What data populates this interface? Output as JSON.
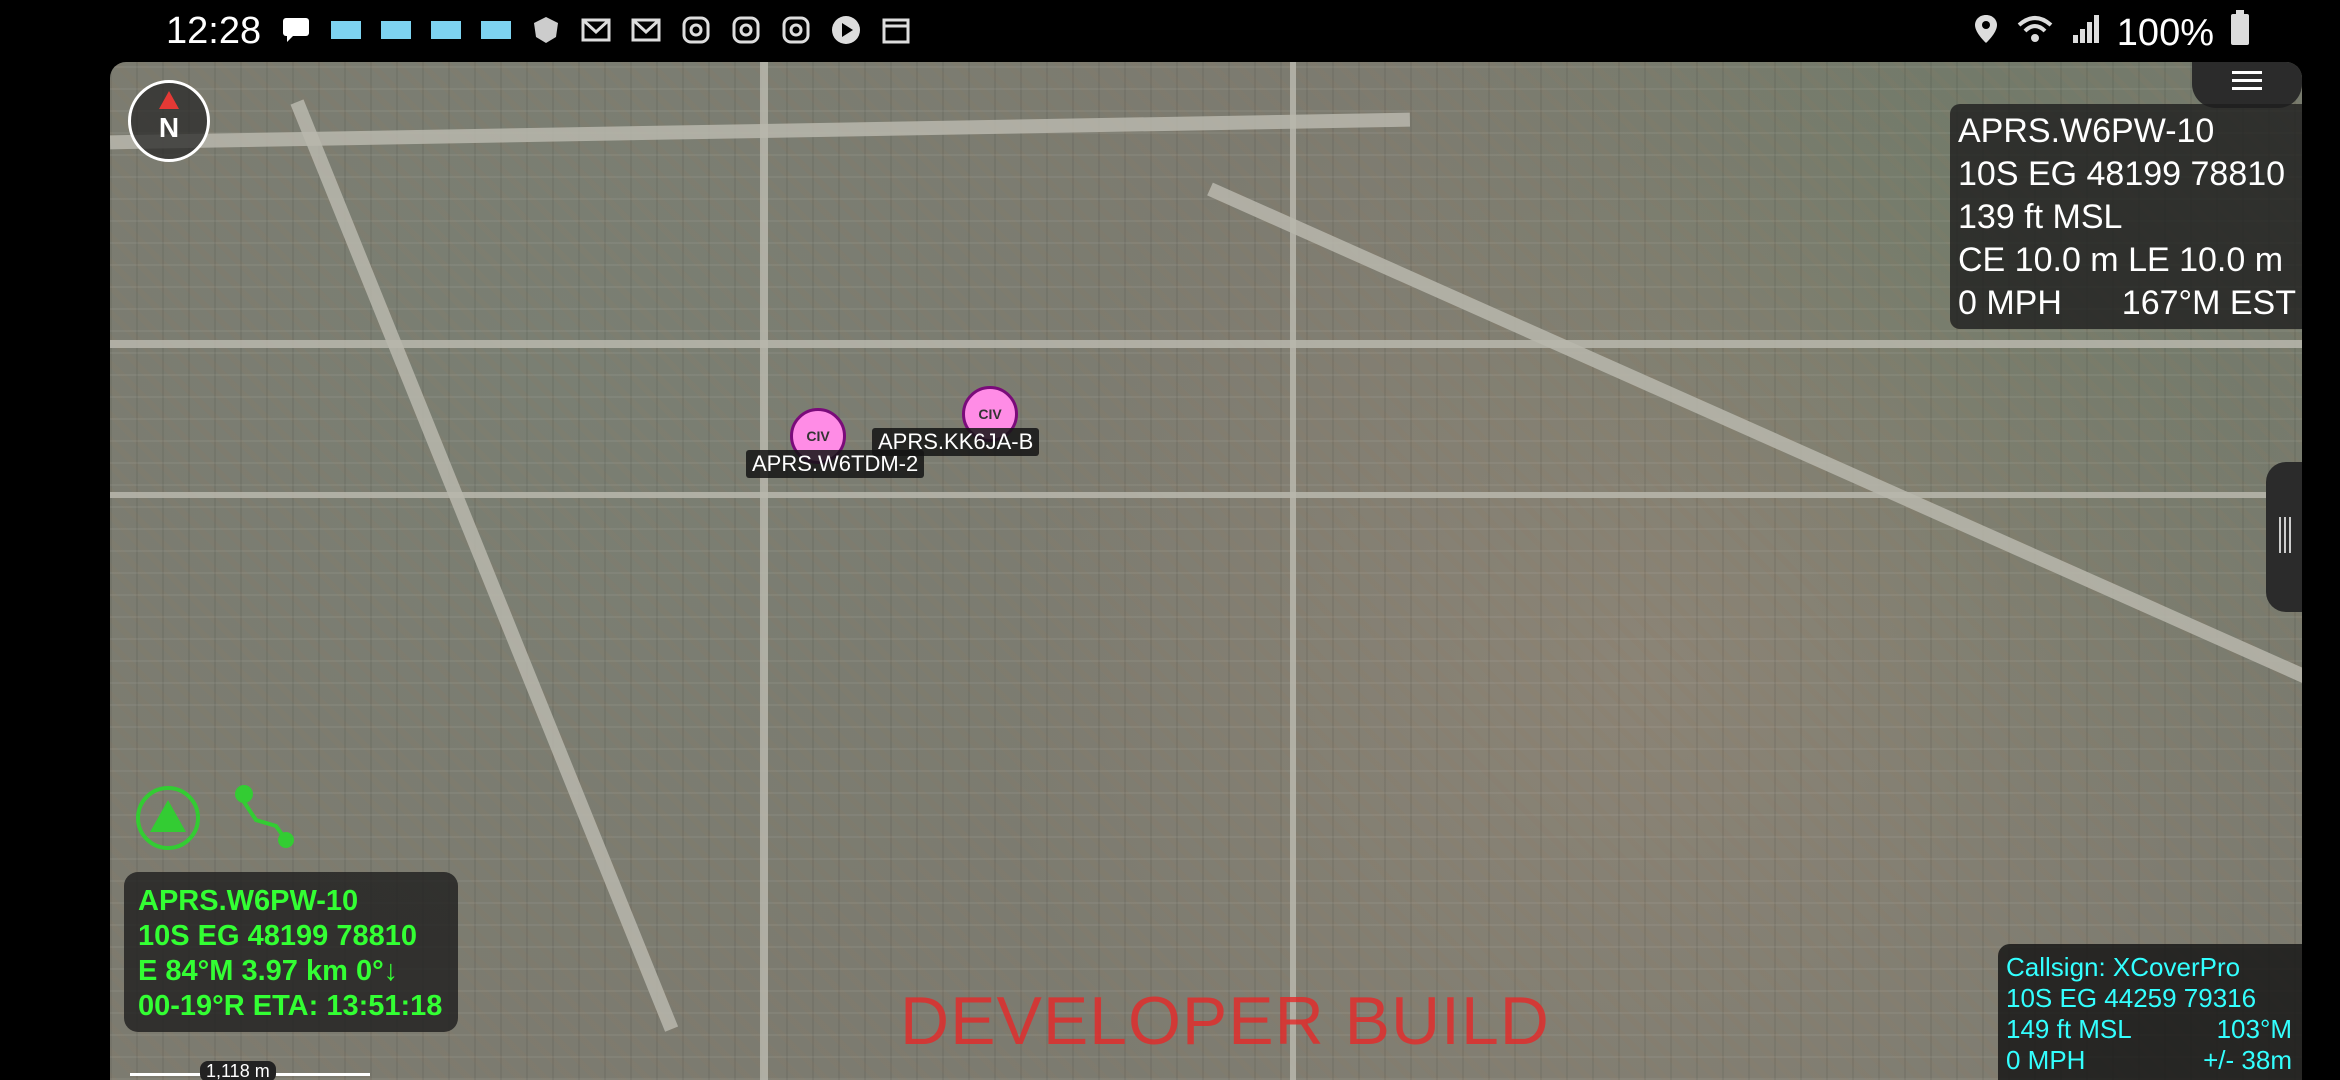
{
  "status_bar": {
    "time": "12:28",
    "battery": "100%",
    "left_icons": [
      "message-icon",
      "notification-icon",
      "notification-icon",
      "notification-icon",
      "notification-icon",
      "shield-icon",
      "mail-icon",
      "mail-icon",
      "instagram-icon",
      "instagram-icon",
      "instagram-icon",
      "play-icon",
      "calendar-icon"
    ],
    "right_icons": [
      "location-icon",
      "wifi-icon",
      "signal-icon",
      "battery-icon"
    ]
  },
  "map": {
    "compass_label": "N",
    "self_marker": {
      "line1": "APRS.W6PW-10",
      "line2": "10S EG 48199 78810",
      "line3": "139 ft MSL",
      "line4": "CE 10.0 m LE 10.0 m",
      "speed": "0 MPH",
      "heading": "167°M EST"
    },
    "markers": [
      {
        "icon_text": "CIV",
        "label": "APRS.W6TDM-2"
      },
      {
        "icon_text": "CIV",
        "label": "APRS.KK6JA-B"
      }
    ],
    "track_info": {
      "line1": "APRS.W6PW-10",
      "line2": "10S  EG  48199  78810",
      "line3": "E   84°M 3.97 km   0°↓",
      "line4": "00-19°R   ETA: 13:51:18"
    },
    "developer_banner": "DEVELOPER BUILD",
    "callsign_info": {
      "line1": "Callsign: XCoverPro",
      "line2": "10S  EG  44259  79316",
      "line3_left": "149 ft MSL",
      "line3_right": "103°M",
      "line4_left": "0 MPH",
      "line4_right": "+/- 38m"
    },
    "scale_label": "1,118 m"
  }
}
